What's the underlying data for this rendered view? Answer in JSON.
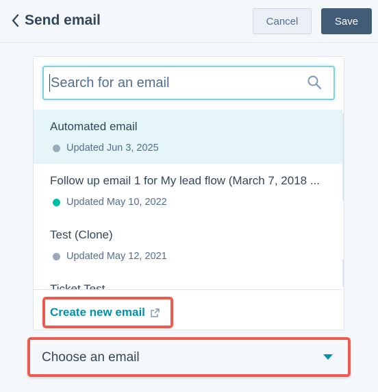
{
  "header": {
    "title": "Send email",
    "cancel_label": "Cancel",
    "save_label": "Save"
  },
  "search": {
    "placeholder": "Search for an email"
  },
  "emails": [
    {
      "title": "Automated email",
      "updated": "Updated Jun 3, 2025",
      "status_color": "#99aabb",
      "selected": true
    },
    {
      "title": "Follow up email 1 for My lead flow (March 7, 2018 ...",
      "updated": "Updated May 10, 2022",
      "status_color": "#00bda5",
      "selected": false
    },
    {
      "title": "Test (Clone)",
      "updated": "Updated May 12, 2021",
      "status_color": "#99aabb",
      "selected": false
    },
    {
      "title": "Ticket Test",
      "updated": "",
      "status_color": "#99aabb",
      "selected": false
    }
  ],
  "create_link": {
    "label": "Create new email"
  },
  "select": {
    "value": "Choose an email"
  },
  "colors": {
    "accent": "#0091ae",
    "highlight": "#ef5a4e",
    "selected_row": "#e5f5f8",
    "primary_button": "#425b76"
  }
}
